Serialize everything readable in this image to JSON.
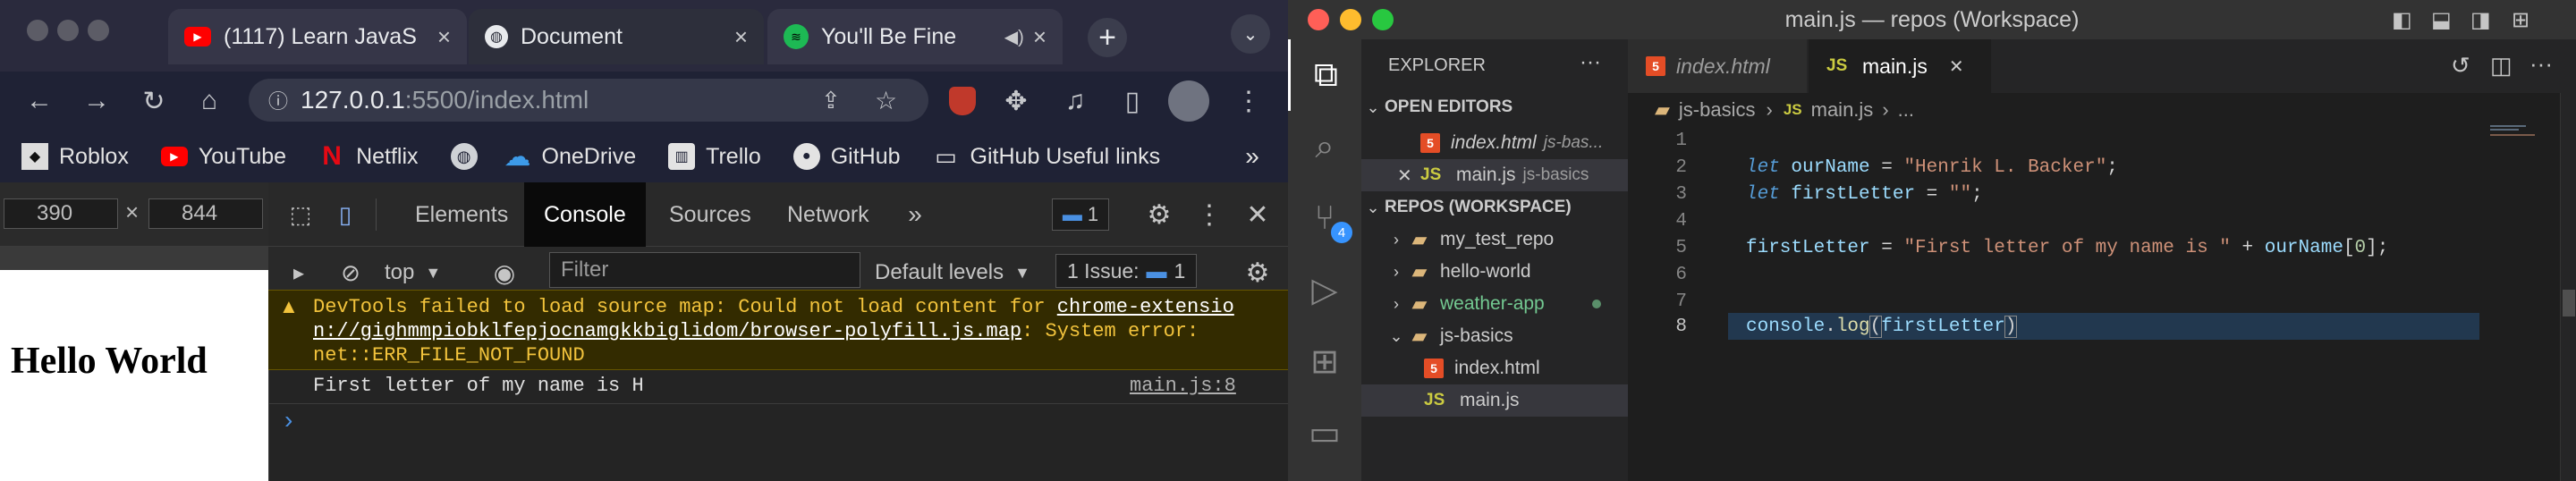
{
  "chrome": {
    "tabs": [
      {
        "label": "(1117) Learn JavaS",
        "icon": "youtube-icon"
      },
      {
        "label": "Document",
        "icon": "globe-icon"
      },
      {
        "label": "You'll Be Fine",
        "icon": "spotify-icon"
      }
    ],
    "new_tab_label": "+",
    "url_host": "127.0.0.1",
    "url_rest": ":5500/index.html",
    "bookmarks": [
      {
        "label": "Roblox"
      },
      {
        "label": "YouTube"
      },
      {
        "label": "Netflix"
      },
      {
        "label": ""
      },
      {
        "label": "OneDrive"
      },
      {
        "label": "Trello"
      },
      {
        "label": "GitHub"
      },
      {
        "label": "GitHub Useful links"
      }
    ],
    "bookmarks_more": "»"
  },
  "page": {
    "width": "390",
    "height": "844",
    "heading": "Hello World"
  },
  "devtools": {
    "tabs": [
      "Elements",
      "Console",
      "Sources",
      "Network"
    ],
    "tabs_more": "»",
    "message_count": "1",
    "context": "top",
    "filter_placeholder": "Filter",
    "levels": "Default levels",
    "issues_label": "1 Issue:",
    "issues_count": "1",
    "warning_prefix": "DevTools failed to load source map: Could not load content for ",
    "warning_link": "chrome-extension://gighmmpiobklfepjocnamgkkbiglidom/browser-polyfill.js.map",
    "warning_link_1": "chrome-extensio",
    "warning_link_2": "n://gighmmpiobklfepjocnamgkkbiglidom/browser-polyfill.js.map",
    "warning_suffix": ": System error:",
    "warning_error": "net::ERR_FILE_NOT_FOUND",
    "log_text": "First letter of my name is H",
    "log_source": "main.js:8",
    "prompt": "›"
  },
  "vscode": {
    "title": "main.js — repos (Workspace)",
    "explorer_title": "EXPLORER",
    "open_editors_title": "OPEN EDITORS",
    "open_editors": [
      {
        "name": "index.html",
        "path": "js-bas..."
      },
      {
        "name": "main.js",
        "path": "js-basics"
      }
    ],
    "workspace_title": "REPOS (WORKSPACE)",
    "tree": [
      {
        "name": "my_test_repo"
      },
      {
        "name": "hello-world"
      },
      {
        "name": "weather-app"
      },
      {
        "name": "js-basics"
      },
      {
        "name": "index.html"
      },
      {
        "name": "main.js"
      }
    ],
    "scm_badge": "4",
    "editor_tabs": [
      {
        "name": "index.html"
      },
      {
        "name": "main.js"
      }
    ],
    "breadcrumb": {
      "folder": "js-basics",
      "file": "main.js",
      "tail": "..."
    },
    "line_numbers": [
      "1",
      "2",
      "3",
      "4",
      "5",
      "6",
      "7",
      "8"
    ],
    "code": {
      "l2_kw": "let",
      "l2_var": "ourName",
      "l2_op": " = ",
      "l2_str": "\"Henrik L. Backer\"",
      "l2_end": ";",
      "l3_kw": "let",
      "l3_var": "firstLetter",
      "l3_op": " = ",
      "l3_str": "\"\"",
      "l3_end": ";",
      "l5_var": "firstLetter",
      "l5_op": " = ",
      "l5_str": "\"First letter of my name is \"",
      "l5_plus": " + ",
      "l5_var2": "ourName",
      "l5_b1": "[",
      "l5_num": "0",
      "l5_b2": "];",
      "l8_obj": "console",
      "l8_dot": ".",
      "l8_fn": "log",
      "l8_p1": "(",
      "l8_arg": "firstLetter",
      "l8_p2": ")"
    }
  }
}
